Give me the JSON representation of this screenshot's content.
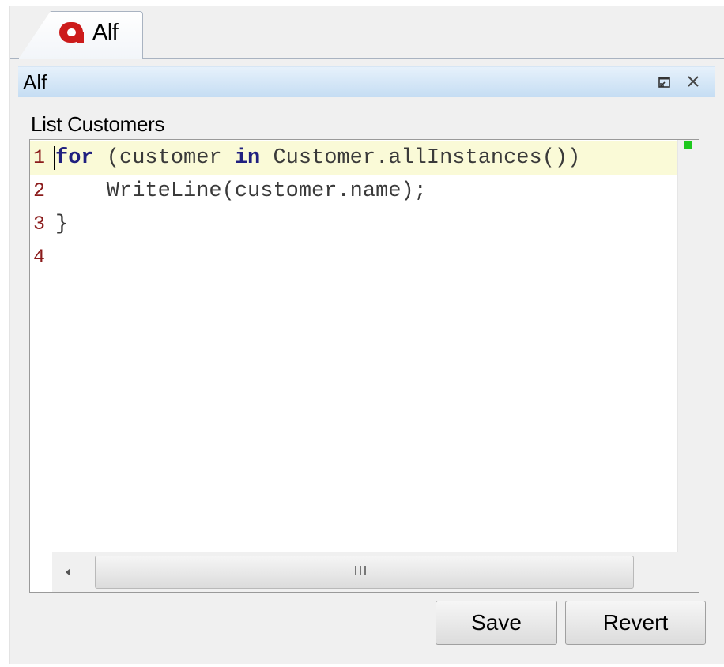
{
  "tab": {
    "label": "Alf",
    "icon": "alf-logo-icon",
    "icon_color": "#cc1b1b"
  },
  "view": {
    "title": "Alf",
    "restore_icon": "restore-icon",
    "close_icon": "close-icon"
  },
  "editor": {
    "section_label": "List Customers",
    "lines": [
      {
        "number": "1",
        "keyword": "for",
        "rest_before": " (customer ",
        "keyword2": "in",
        "rest_after": " Customer.allInstances())"
      },
      {
        "number": "2",
        "text": "    WriteLine(customer.name);"
      },
      {
        "number": "3",
        "text": "}"
      },
      {
        "number": "4",
        "text": ""
      }
    ],
    "keyword_color": "#20207f",
    "line_number_color": "#8b1b1b",
    "current_line_bg": "#fafad7",
    "ruler_marker_color": "#1ec81e"
  },
  "scrollbar": {
    "left_arrow_icon": "scroll-left-icon",
    "right_arrow_icon": "scroll-right-icon"
  },
  "buttons": {
    "save": "Save",
    "revert": "Revert"
  }
}
